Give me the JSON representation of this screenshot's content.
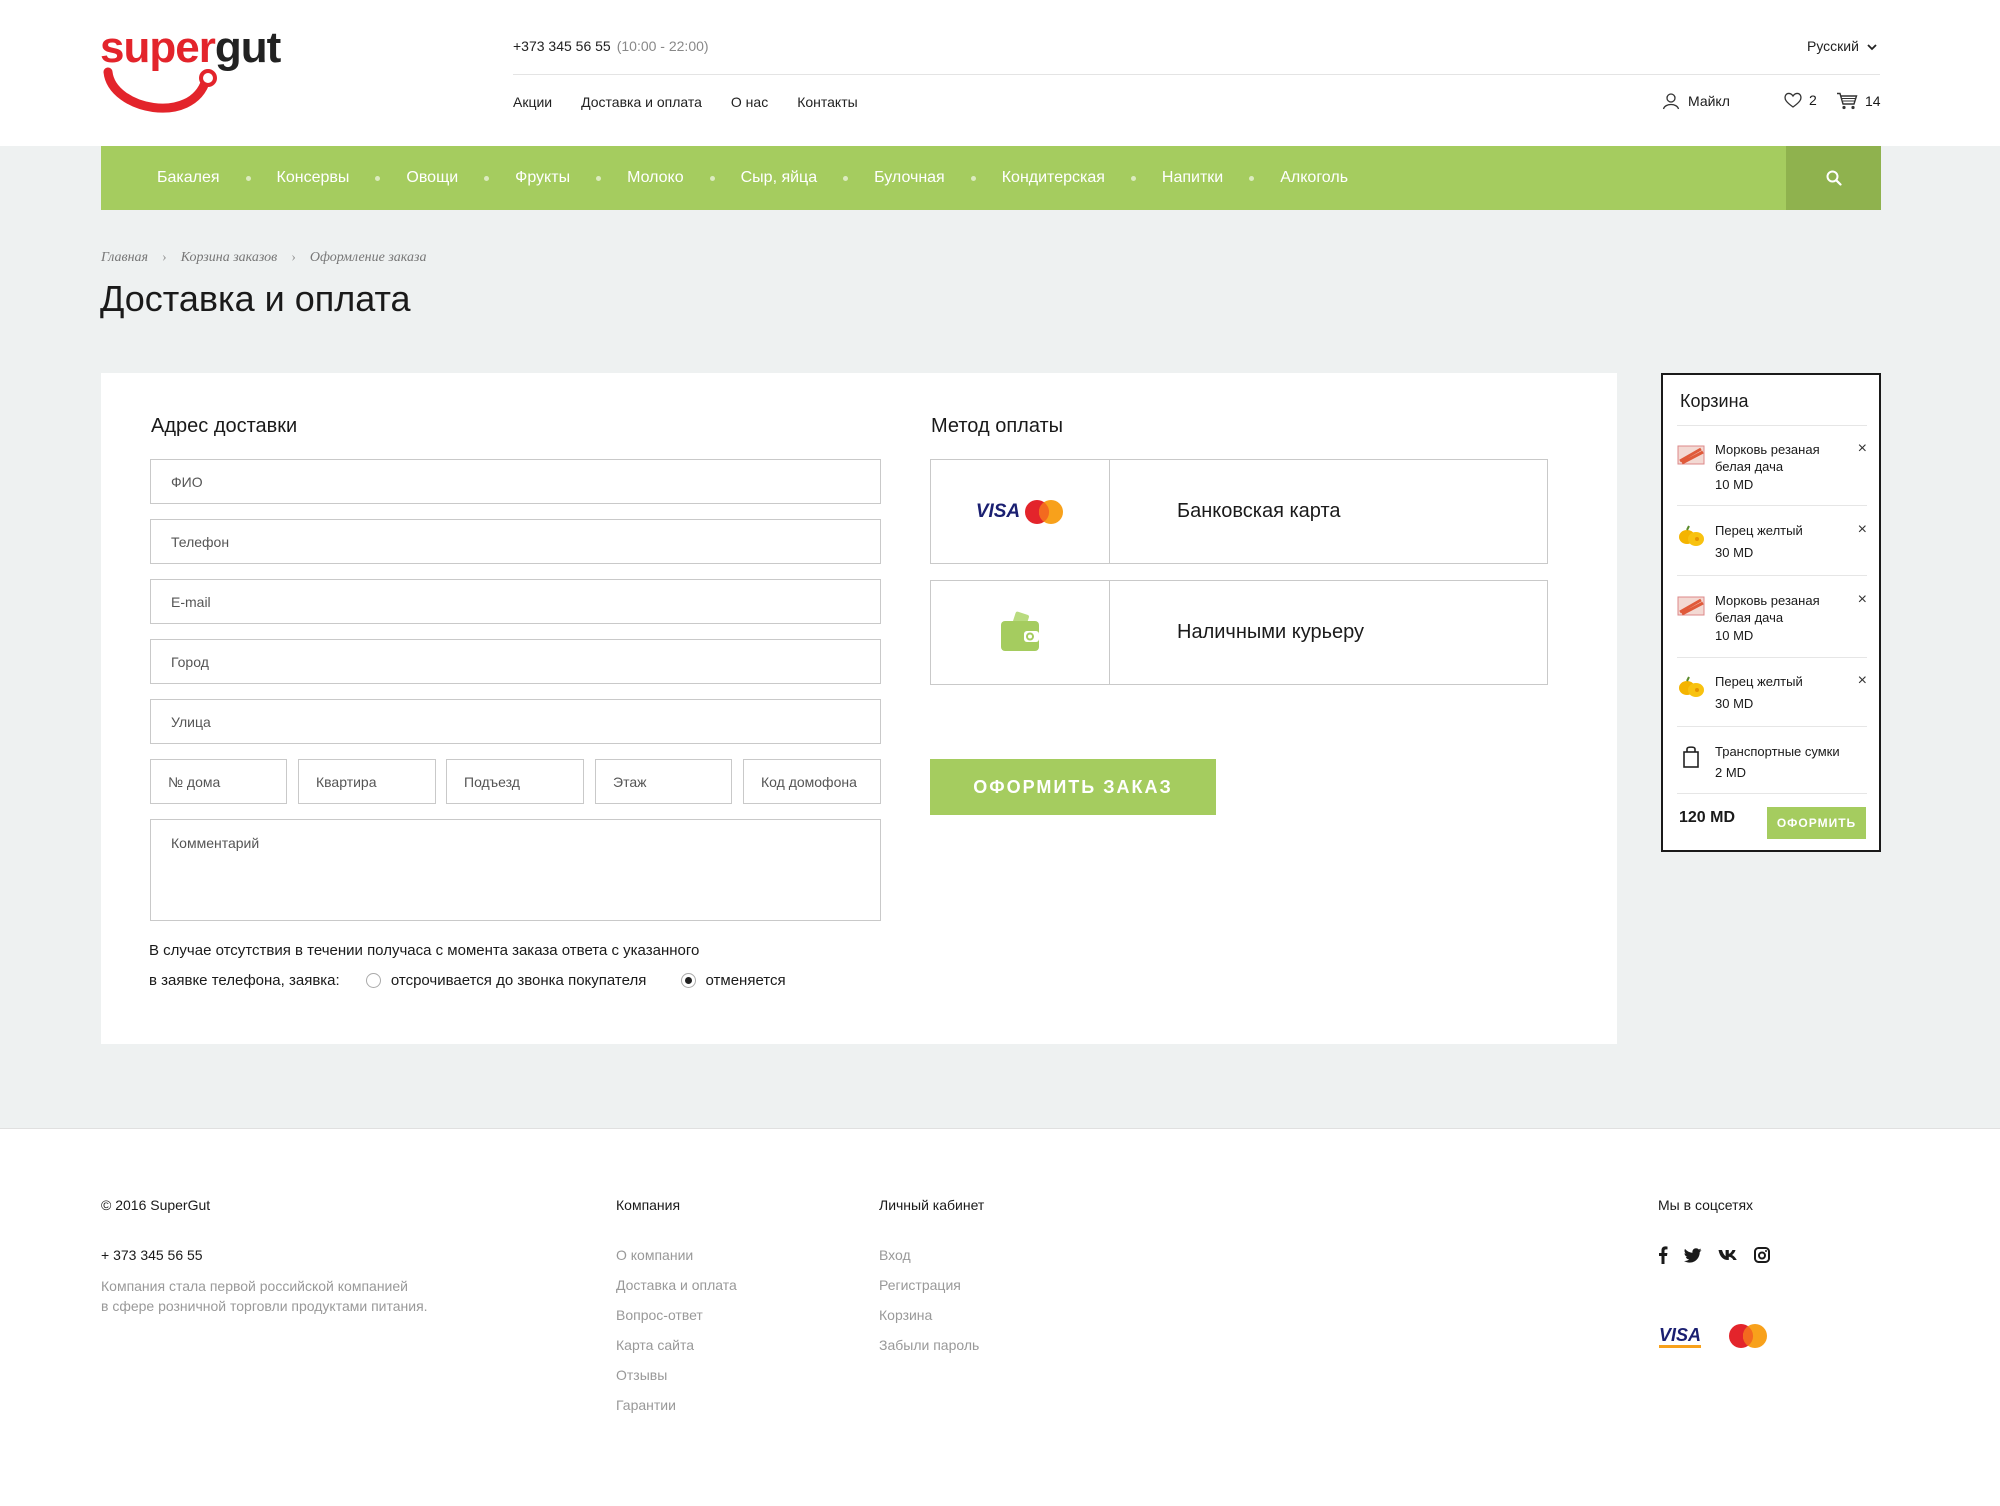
{
  "brand": {
    "logo_part1": "super",
    "logo_part2": "gut",
    "red_color": "#e3242b",
    "accent_color": "#a5cc5f"
  },
  "header": {
    "phone": "+373 345 56 55",
    "hours": "(10:00 - 22:00)",
    "language": "Русский",
    "nav": [
      "Акции",
      "Доставка и оплата",
      "О нас",
      "Контакты"
    ],
    "user_name": "Майкл",
    "favorites_count": "2",
    "cart_count": "14"
  },
  "categories": [
    "Бакалея",
    "Консервы",
    "Овощи",
    "Фрукты",
    "Молоко",
    "Сыр, яйца",
    "Булочная",
    "Кондитерская",
    "Напитки",
    "Алкоголь"
  ],
  "breadcrumbs": [
    "Главная",
    "Корзина заказов",
    "Оформление заказа"
  ],
  "page_title": "Доставка и оплата",
  "address": {
    "title": "Адрес доставки",
    "fields": {
      "fio": "ФИО",
      "phone": "Телефон",
      "email": "E-mail",
      "city": "Город",
      "street": "Улица",
      "house": "№ дома",
      "apartment": "Квартира",
      "entrance": "Подъезд",
      "floor": "Этаж",
      "intercom": "Код домофона",
      "comment": "Комментарий"
    },
    "note_line1": "В случае отсутствия в течении получаса с момента заказа ответа с указанного",
    "note_line2": "в заявке телефона, заявка:",
    "option_postpone": "отсрочивается до звонка покупателя",
    "option_cancel": "отменяется",
    "selected_option": "отменяется"
  },
  "payment": {
    "title": "Метод оплаты",
    "card_label": "Банковская карта",
    "cash_label": "Наличными курьеру",
    "visa_text": "VISA",
    "mastercard_text": "MasterCard",
    "order_button": "ОФОРМИТЬ ЗАКАЗ"
  },
  "cart": {
    "title": "Корзина",
    "items": [
      {
        "name": "Морковь резаная белая дача",
        "price": "10 MD",
        "icon": "carrot-icon"
      },
      {
        "name": "Перец желтый",
        "price": "30 MD",
        "icon": "pepper-icon"
      },
      {
        "name": "Морковь резаная белая дача",
        "price": "10 MD",
        "icon": "carrot-icon"
      },
      {
        "name": "Перец желтый",
        "price": "30 MD",
        "icon": "pepper-icon"
      },
      {
        "name": "Транспортные сумки",
        "price": "2 MD",
        "icon": "bag-icon"
      }
    ],
    "remove_symbol": "×",
    "total": "120 MD",
    "checkout_button": "ОФОРМИТЬ"
  },
  "footer": {
    "copyright": "© 2016 SuperGut",
    "phone": "+ 373 345 56 55",
    "about_line1": "Компания стала первой российской компанией",
    "about_line2": "в сфере розничной торговли продуктами питания.",
    "company_title": "Компания",
    "company_links": [
      "О компании",
      "Доставка и оплата",
      "Вопрос-ответ",
      "Карта сайта",
      "Отзывы",
      "Гарантии"
    ],
    "account_title": "Личный кабинет",
    "account_links": [
      "Вход",
      "Регистрация",
      "Корзина",
      "Забыли пароль"
    ],
    "social_title": "Мы в соцсетях",
    "social_icons": [
      "facebook-icon",
      "twitter-icon",
      "vk-icon",
      "instagram-icon"
    ],
    "visa_text": "VISA",
    "mastercard_text": "MasterCard"
  }
}
